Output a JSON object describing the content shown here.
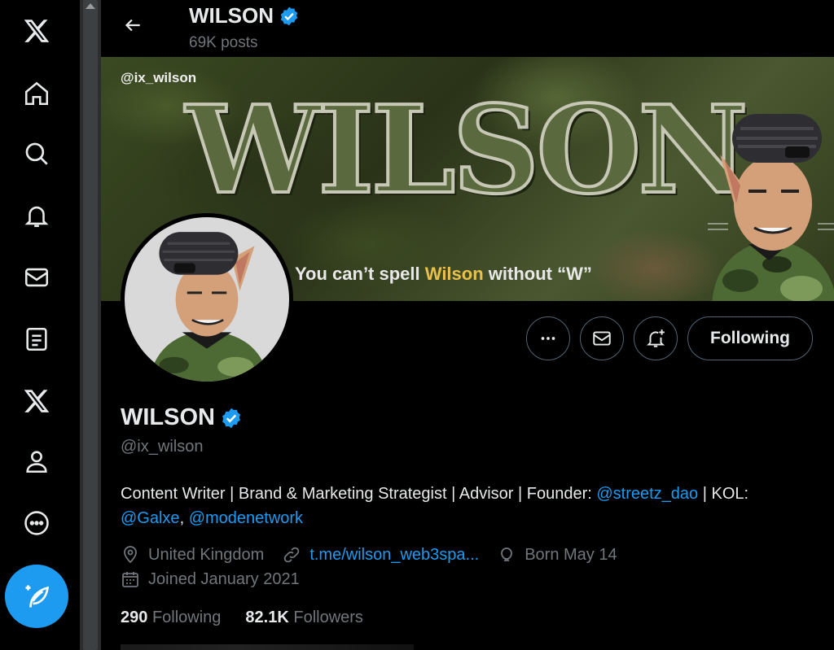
{
  "nav": {
    "items": [
      {
        "icon": "x-logo-icon"
      },
      {
        "icon": "home-icon"
      },
      {
        "icon": "search-icon"
      },
      {
        "icon": "notifications-icon"
      },
      {
        "icon": "messages-icon"
      },
      {
        "icon": "lists-icon"
      },
      {
        "icon": "premium-x-icon"
      },
      {
        "icon": "profile-icon"
      },
      {
        "icon": "more-icon"
      }
    ],
    "compose_icon": "compose-post-icon"
  },
  "header": {
    "name": "WILSON",
    "posts": "69K posts"
  },
  "banner": {
    "handle": "@ix_wilson",
    "title": "WILSON",
    "tagline_pre": "You can’t spell ",
    "tagline_highlight": "Wilson",
    "tagline_post": " without “W”"
  },
  "actions": {
    "more_icon": "more-dots-icon",
    "message_icon": "mail-icon",
    "notify_icon": "bell-plus-icon",
    "follow_label": "Following"
  },
  "profile": {
    "name": "WILSON",
    "handle": "@ix_wilson",
    "bio_part1": "Content Writer | Brand & Marketing Strategist | Advisor | Founder: ",
    "bio_link1": "@streetz_dao",
    "bio_part2": " | KOL: ",
    "bio_link2": "@Galxe",
    "bio_part3": ", ",
    "bio_link3": "@modenetwork",
    "location": "United Kingdom",
    "website": "t.me/wilson_web3spa...",
    "birthday": "Born May 14",
    "joined": "Joined January 2021",
    "following_count": "290",
    "following_label": "Following",
    "followers_count": "82.1K",
    "followers_label": "Followers"
  },
  "colors": {
    "accent": "#1d9bf0",
    "verified": "#1d9bf0",
    "muted": "#71767b",
    "text": "#e7e9ea",
    "background": "#000000"
  }
}
